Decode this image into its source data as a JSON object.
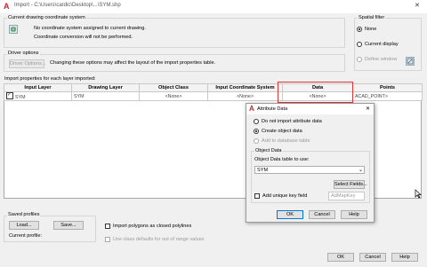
{
  "window": {
    "title": "Import - C:\\Users\\cardic\\Desktop\\...\\SYM.shp"
  },
  "coord": {
    "heading": "Current drawing coordinate system",
    "line1": "No coordinate system assigned to current drawing.",
    "line2": "Coordinate conversion will not be performed."
  },
  "spatial": {
    "heading": "Spatial filter",
    "none": "None",
    "current_display": "Current display",
    "define_window": "Define window"
  },
  "driver": {
    "heading": "Driver options",
    "button": "Driver Options...",
    "note": "Changing these options may affect the layout of the import properties table."
  },
  "props": {
    "heading": "Import properties for each layer imported:",
    "columns": [
      "Input Layer",
      "Drawing Layer",
      "Object Class",
      "Input Coordinate System",
      "Data",
      "Points"
    ],
    "row": [
      "SYM",
      "SYM",
      "<None>",
      "<None>",
      "<None>",
      "ACAD_POINT>"
    ]
  },
  "profiles": {
    "heading": "Saved profiles",
    "load": "Load...",
    "save": "Save...",
    "current_label": "Current profile:"
  },
  "options": {
    "import_polygons": "Import polygons as closed polylines",
    "class_defaults": "Use class defaults for out of range values"
  },
  "footer": {
    "ok": "OK",
    "cancel": "Cancel",
    "help": "Help"
  },
  "attr": {
    "title": "Attribute Data",
    "do_not_import": "Do not import attribute data",
    "create_object_data": "Create object data",
    "add_to_db": "Add to database table",
    "group": "Object Data",
    "table_label": "Object Data table to use:",
    "table_value": "SYM",
    "select_fields": "Select Fields...",
    "add_unique": "Add unique key field",
    "key_field": "AdMapKey",
    "ok": "OK",
    "cancel": "Cancel",
    "help": "Help"
  },
  "colors": {
    "highlight": "#e03535",
    "accent": "#0078d7",
    "brand": "#c1272d"
  }
}
